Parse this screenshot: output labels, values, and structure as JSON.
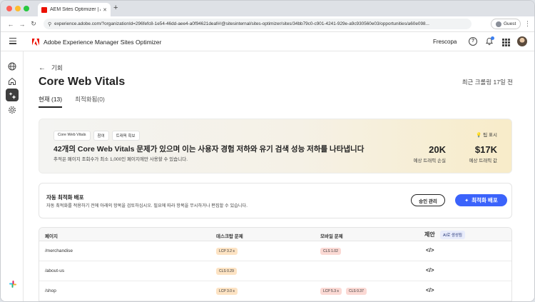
{
  "browser": {
    "tab_title": "AEM Sites Optimizer | Adobe",
    "url": "experience.adobe.com/?organizationId=296fefc8-1e54-46dd-aee4-a0f94621deaf#/@sitesinternal/sites-optimizer/sites/34bb79c0-c901-4241-929e-a9c930560e03/opportunities/a60e098...",
    "guest_label": "Guest"
  },
  "header": {
    "app_title": "Adobe Experience Manager Sites Optimizer",
    "org_name": "Frescopa"
  },
  "page": {
    "back_label": "기회",
    "title": "Core Web Vitals",
    "last_crawl": "최근 크롤링 17일 전",
    "tabs": [
      {
        "label": "현재 (13)",
        "active": true
      },
      {
        "label": "최적화됨(0)",
        "active": false
      }
    ]
  },
  "banner": {
    "badges": [
      "Core Web Vitals",
      "참여",
      "트래픽 획보"
    ],
    "title": "42개의 Core Web Vitals 문제가 있으며 이는 사용자 경험 저하와 유기 검색 성능 저하를 나타냅니다",
    "subtitle": "추적은 페이지 조회수가 최소 1,000인 페이지에만 사용할 수 있습니다.",
    "tips_label": "팁 표시",
    "stats": [
      {
        "value": "20K",
        "label": "예상 트래픽 손실"
      },
      {
        "value": "$17K",
        "label": "예상 트래픽 값"
      }
    ]
  },
  "deploy": {
    "title": "자동 최적화 배포",
    "subtitle": "자동 최적화를 적용하기 전에 아래의 항목을 검토하십시오. 필요에 따라 항목을 무시하거나 편집할 수 있습니다.",
    "approve_label": "승인 관리",
    "deploy_label": "최적화 배포"
  },
  "table": {
    "headers": {
      "page": "페이지",
      "desktop": "데스크탑 문제",
      "mobile": "모바일 문제",
      "suggest": "제안",
      "ai_tag": "AI로 생성됨"
    },
    "rows": [
      {
        "page": "/merchandise",
        "desktop": [
          {
            "text": "LCP 3.2 s",
            "tone": "orange"
          }
        ],
        "mobile": [
          {
            "text": "CLS 1.02",
            "tone": "pink"
          }
        ]
      },
      {
        "page": "/about-us",
        "desktop": [
          {
            "text": "CLS 0.29",
            "tone": "orange"
          }
        ],
        "mobile": []
      },
      {
        "page": "/shop",
        "desktop": [
          {
            "text": "LCP 3.0 s",
            "tone": "orange"
          }
        ],
        "mobile": [
          {
            "text": "LCP 5.3 s",
            "tone": "pink"
          },
          {
            "text": "CLS 0.37",
            "tone": "pink"
          }
        ]
      }
    ]
  },
  "icons": {
    "back": "arrow-left-icon",
    "code": "code-icon",
    "tips": "lightbulb-icon",
    "deploy": "sparkle-icon"
  },
  "colors": {
    "primary": "#3b63fb",
    "adobe_red": "#eb1000",
    "chip_orange": "#fde3c3",
    "chip_pink": "#fbd9d4"
  }
}
